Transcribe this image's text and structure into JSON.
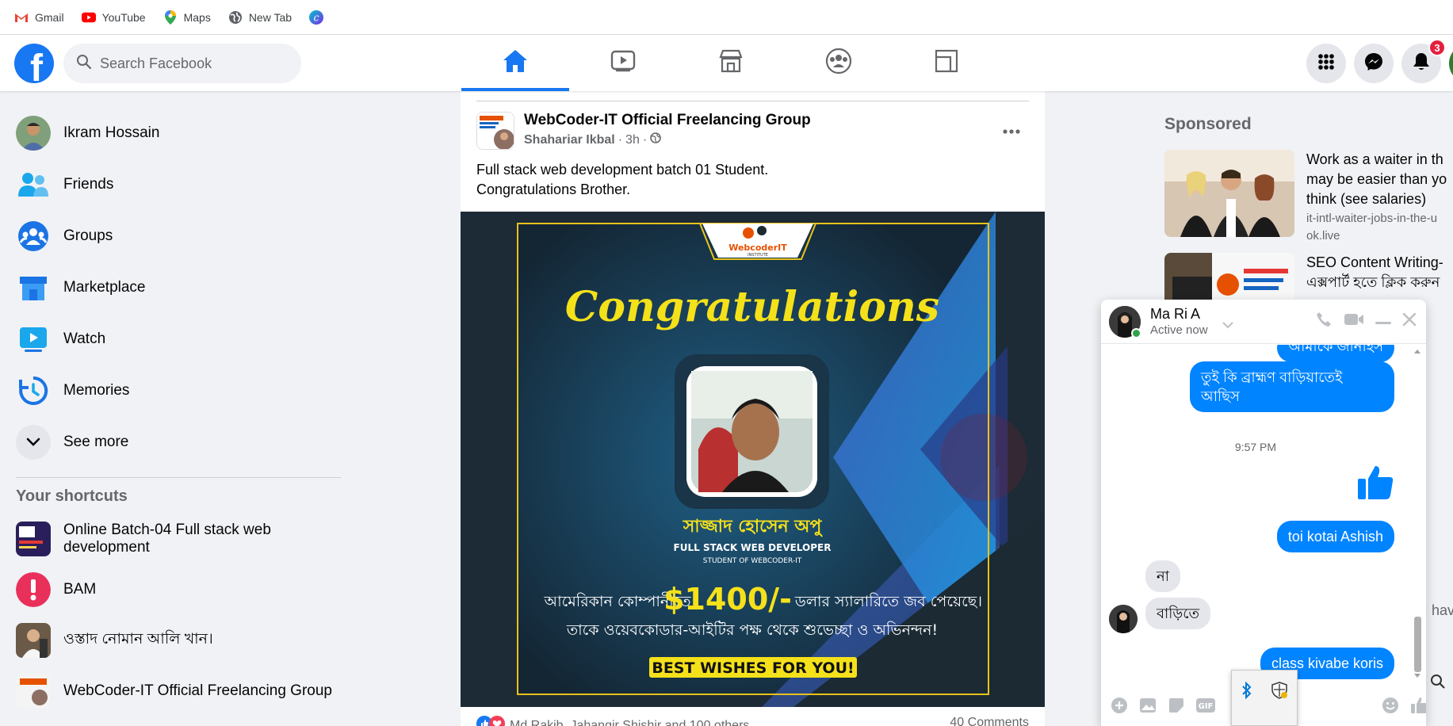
{
  "bookmarks": [
    {
      "label": "Gmail",
      "icon": "gmail-icon"
    },
    {
      "label": "YouTube",
      "icon": "youtube-icon"
    },
    {
      "label": "Maps",
      "icon": "maps-icon"
    },
    {
      "label": "New Tab",
      "icon": "globe-icon"
    },
    {
      "label": "",
      "icon": "canva-icon"
    }
  ],
  "topnav": {
    "search_placeholder": "Search Facebook",
    "notification_count": "3",
    "brand_color": "#1877f2"
  },
  "leftnav": {
    "items": [
      {
        "label": "Ikram Hossain",
        "icon": "profile-avatar"
      },
      {
        "label": "Friends",
        "icon": "friends-icon"
      },
      {
        "label": "Groups",
        "icon": "groups-icon"
      },
      {
        "label": "Marketplace",
        "icon": "marketplace-icon"
      },
      {
        "label": "Watch",
        "icon": "watch-icon"
      },
      {
        "label": "Memories",
        "icon": "memories-icon"
      },
      {
        "label": "See more",
        "icon": "chevron-down-icon"
      }
    ],
    "shortcuts_title": "Your shortcuts",
    "shortcuts": [
      {
        "label": "Online Batch-04 Full stack web development"
      },
      {
        "label": "BAM"
      },
      {
        "label": "ওস্তাদ নোমান আলি খান।"
      },
      {
        "label": "WebCoder-IT Official Freelancing Group"
      }
    ]
  },
  "post": {
    "group": "WebCoder-IT Official Freelancing Group",
    "author": "Shahariar Ikbal",
    "time": "3h",
    "text_line1": "Full stack web development batch 01 Student.",
    "text_line2": "Congratulations Brother.",
    "image": {
      "brand": "WebcoderIT",
      "brand_sub": "INSTITUTE",
      "heading": "Congratulations",
      "name": "সাজ্জাদ হোসেন অপু",
      "role": "FULL STACK WEB DEVELOPER",
      "sub_role": "STUDENT OF WEBCODER-IT",
      "line1_pre": "আমেরিকান কোম্পানীতে",
      "line1_amount": "$1400/-",
      "line1_post": "ডলার স্যালারিতে জব পেয়েছে।",
      "line2": "তাকে ওয়েবকোডার-আইটির পক্ষ থেকে শুভেচ্ছা ও অভিনন্দন!",
      "banner": "BEST WISHES FOR YOU!"
    },
    "reactions": "Md Rakib, Jahangir Shishir and 100 others",
    "comments": "40 Comments"
  },
  "sponsored": {
    "title": "Sponsored",
    "ads": [
      {
        "title_lines": [
          "Work as a waiter in th",
          "may be easier than yo",
          "think (see salaries)"
        ],
        "url_lines": [
          "it-intl-waiter-jobs-in-the-u",
          "ok.live"
        ]
      },
      {
        "title_lines": [
          "SEO Content Writing-",
          "এক্সপার্ট হতে ক্লিক করুন"
        ],
        "url_lines": []
      }
    ]
  },
  "chat": {
    "name": "Ma Ri A",
    "status": "Active now",
    "messages": {
      "out1_partial": "আমাকে জানাইস",
      "out2_line1": "তুই কি ব্রাহ্মণ বাড়িয়াতেই",
      "out2_line2": "আছিস",
      "time": "9:57 PM",
      "out3": "toi kotai Ashish",
      "in1": "না",
      "in2": "বাড়িতে",
      "out4_partial": "class kivabe koris"
    }
  },
  "edge_text": {
    "have": "have"
  }
}
